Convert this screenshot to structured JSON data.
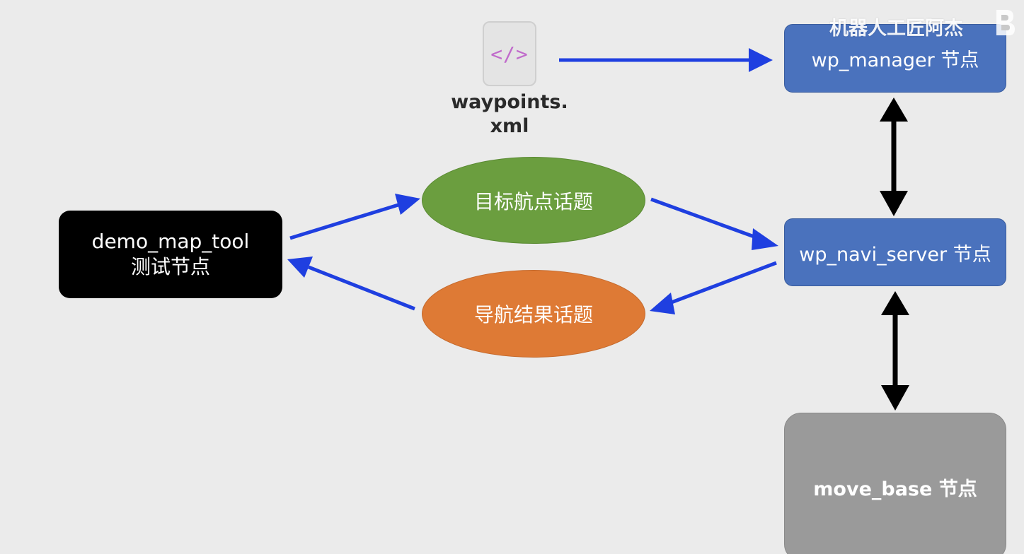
{
  "watermark": {
    "text": "机器人工匠阿杰"
  },
  "file": {
    "icon_glyph": "</>",
    "icon_name": "code-file-icon",
    "label_line1": "waypoints.",
    "label_line2": "xml"
  },
  "nodes": {
    "wp_manager": "wp_manager 节点",
    "wp_navi_server": "wp_navi_server 节点",
    "move_base": "move_base 节点",
    "demo_map_tool_line1": "demo_map_tool",
    "demo_map_tool_line2": "测试节点"
  },
  "topics": {
    "goal": "目标航点话题",
    "result": "导航结果话题"
  },
  "colors": {
    "background": "#ebebeb",
    "node_blue": "#4a72bd",
    "node_black": "#000000",
    "node_gray": "#9a9a9a",
    "topic_green": "#6b9e3f",
    "topic_orange": "#de7a35",
    "arrow_blue": "#1f3fe0",
    "arrow_black": "#000000"
  }
}
